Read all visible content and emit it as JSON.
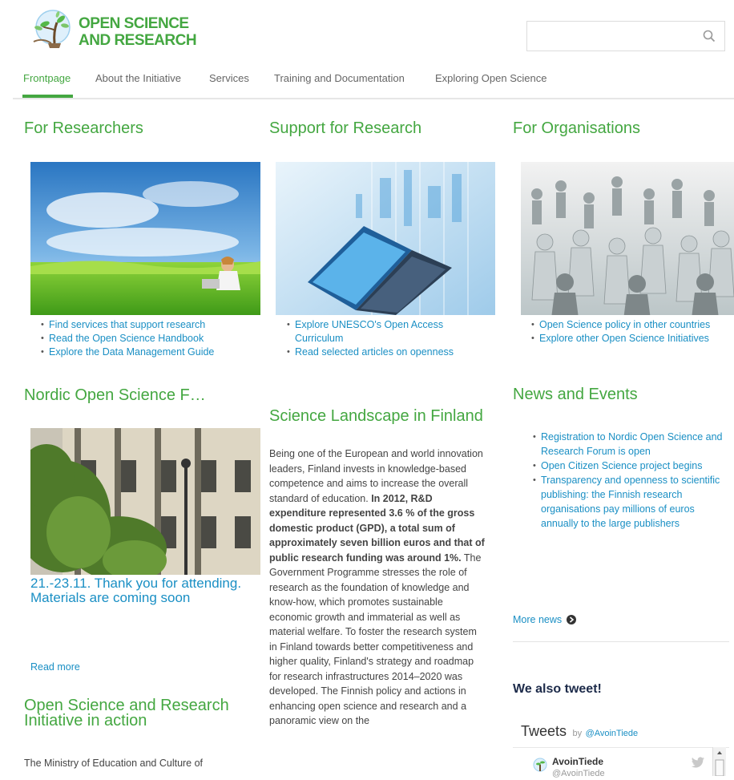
{
  "header": {
    "logo_line1": "OPEN SCIENCE",
    "logo_line2": "AND RESEARCH",
    "search_placeholder": ""
  },
  "nav": {
    "items": [
      "Frontpage",
      "About the Initiative",
      "Services",
      "Training and Documentation",
      "Exploring Open Science"
    ]
  },
  "researchers": {
    "title": "For Researchers",
    "links": [
      "Find services that support research",
      "Read the Open Science Handbook",
      "Explore the Data Management Guide"
    ]
  },
  "support": {
    "title": "Support for Research",
    "links": [
      "Explore UNESCO's Open Access Curriculum",
      "Read selected articles on openness"
    ]
  },
  "organisations": {
    "title": "For Organisations",
    "links": [
      "Open Science policy in other countries",
      "Explore other Open Science Initiatives"
    ]
  },
  "nordic": {
    "title": "Nordic Open Science F…",
    "headline": "21.-23.11. Thank you for attending. Materials are coming soon",
    "read_more": "Read more"
  },
  "landscape": {
    "title": "Science Landscape in Finland",
    "intro": "Being one of the European and world innovation leaders, Finland invests in knowledge-based competence and aims to increase the overall standard of education.",
    "bold": "In 2012, R&D expenditure represented 3.6 % of the gross domestic product (GPD), a total sum of approximately seven billion euros and that of public research funding was around 1%.",
    "rest": "The Government Programme stresses the role of research as the foundation of knowledge and know-how, which promotes sustainable economic growth and immaterial as well as material welfare. To foster the research system in Finland towards better competitiveness and higher quality, Finland's strategy and roadmap for research infrastructures 2014–2020 was developed. The Finnish policy and actions in enhancing open science and research and a panoramic view on the"
  },
  "initiative": {
    "title": "Open Science and Research Initiative in action",
    "text": "The Ministry of Education and Culture of"
  },
  "news": {
    "title": "News and Events",
    "items": [
      "Registration to Nordic Open Science and Research Forum is open",
      "Open Citizen Science project begins",
      "Transparency and openness to scientific publishing: the Finnish research organisations pay millions of euros annually to the large publishers"
    ],
    "more": "More news"
  },
  "tweet": {
    "heading": "We also tweet!",
    "widget_title": "Tweets",
    "by": "by",
    "handle_link": "@AvoinTiede",
    "user_name": "AvoinTiede",
    "user_handle": "@AvoinTiede"
  },
  "colors": {
    "brand_green": "#44a741",
    "link_blue": "#1a8fc4"
  }
}
